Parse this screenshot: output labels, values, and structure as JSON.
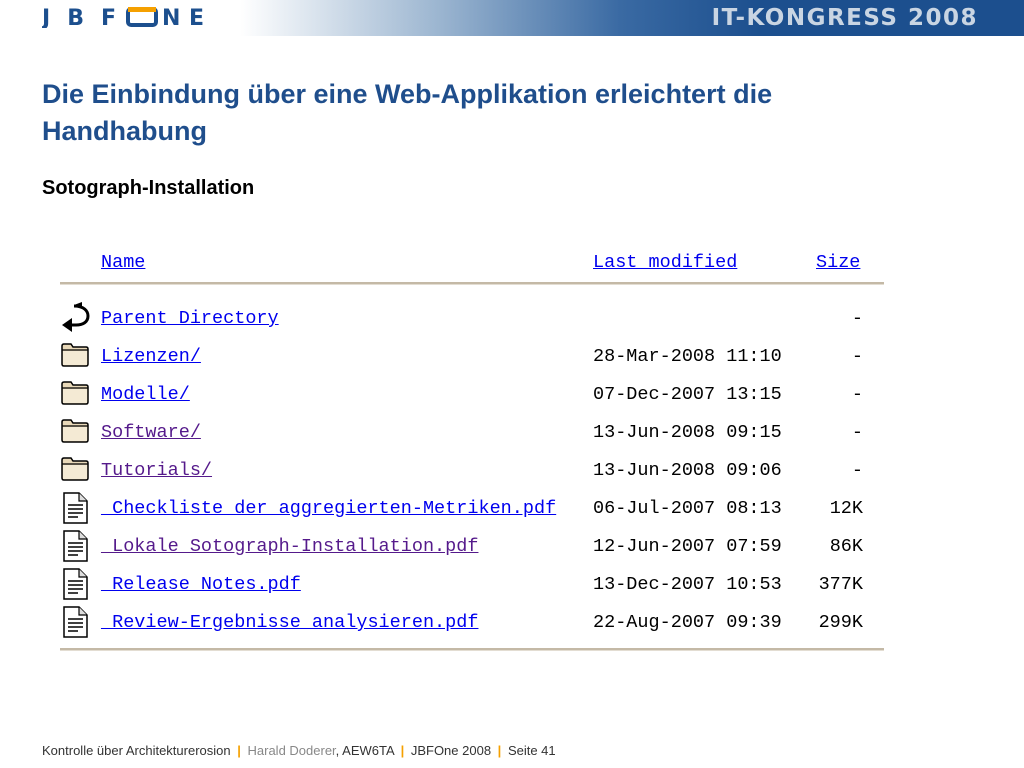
{
  "header": {
    "logo_text": "JBFONE",
    "congress": "IT-KONGRESS 2008"
  },
  "title": "Die Einbindung über eine Web-Applikation erleichtert die Handhabung",
  "subtitle": "Sotograph-Installation",
  "listing": {
    "columns": {
      "name": "Name",
      "modified": "Last modified",
      "size": "Size"
    },
    "rows": [
      {
        "icon": "back-icon",
        "name": "Parent Directory",
        "modified": "",
        "size": "-"
      },
      {
        "icon": "folder-icon",
        "name": "Lizenzen/",
        "modified": "28-Mar-2008 11:10",
        "size": "-"
      },
      {
        "icon": "folder-icon",
        "name": "Modelle/",
        "modified": "07-Dec-2007 13:15",
        "size": "-"
      },
      {
        "icon": "folder-icon",
        "name": "Software/",
        "modified": "13-Jun-2008 09:15",
        "size": "-"
      },
      {
        "icon": "folder-icon",
        "name": "Tutorials/",
        "modified": "13-Jun-2008 09:06",
        "size": "-"
      },
      {
        "icon": "document-icon",
        "name": "_Checkliste der aggregierten-Metriken.pdf",
        "modified": "06-Jul-2007 08:13",
        "size": "12K"
      },
      {
        "icon": "document-icon",
        "name": "_Lokale Sotograph-Installation.pdf",
        "modified": "12-Jun-2007 07:59",
        "size": "86K"
      },
      {
        "icon": "document-icon",
        "name": "_Release Notes.pdf",
        "modified": "13-Dec-2007 10:53",
        "size": "377K"
      },
      {
        "icon": "document-icon",
        "name": "_Review-Ergebnisse analysieren.pdf",
        "modified": "22-Aug-2007 09:39",
        "size": "299K"
      }
    ]
  },
  "footer": {
    "topic": "Kontrolle über Architekturerosion",
    "author": "Harald Doderer",
    "company": ", AEW6TA",
    "event": "JBFOne 2008",
    "page": "Seite 41",
    "sep": "|"
  },
  "colors": {
    "title_blue": "#1f4e8c",
    "link": "#0000ee",
    "visited": "#551a8b",
    "footer_sep": "#f5a000"
  }
}
